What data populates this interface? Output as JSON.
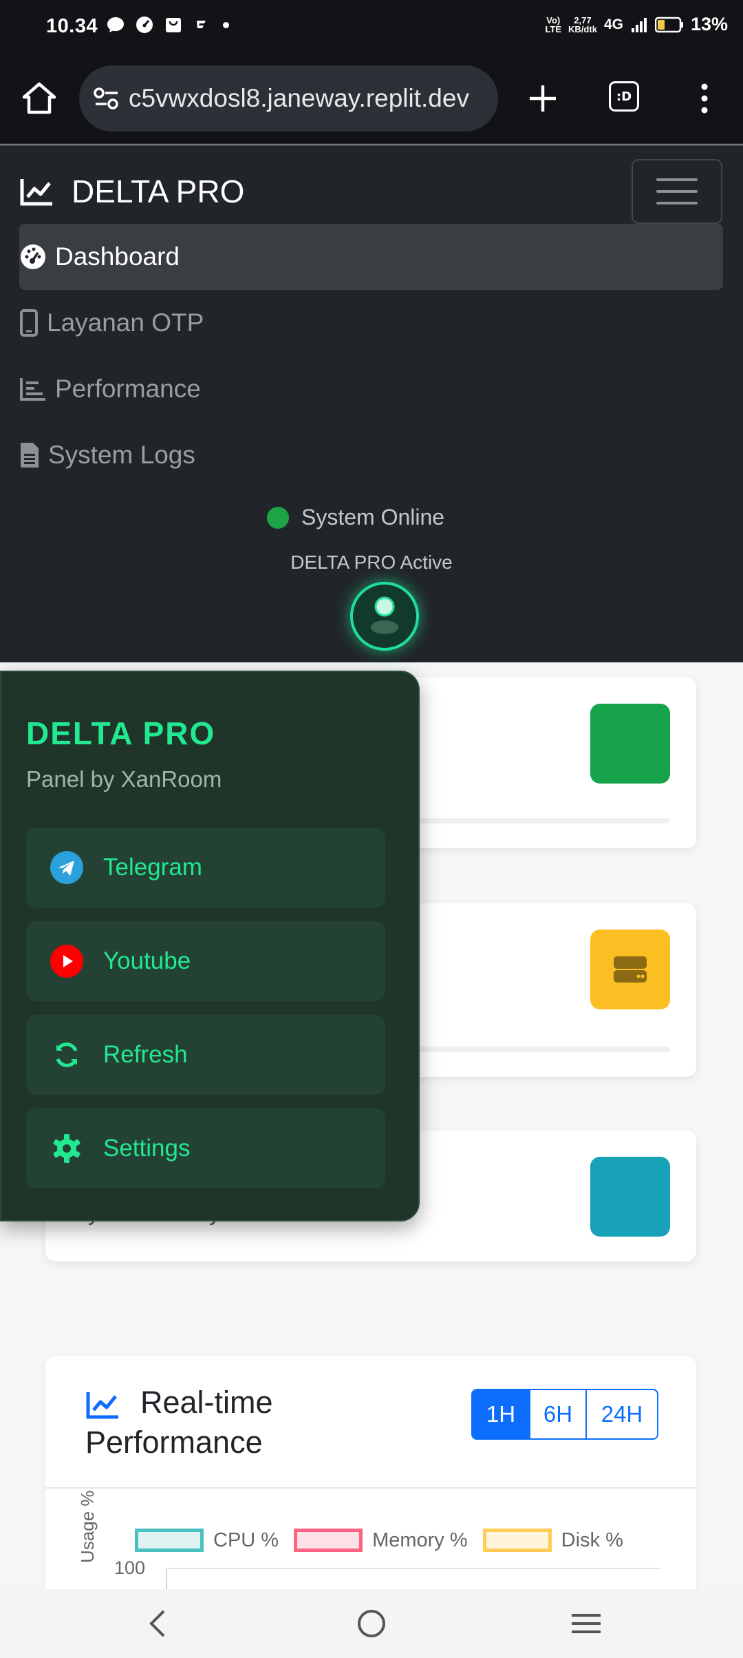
{
  "status_bar": {
    "time": "10.34",
    "lte_label": "VoLTE",
    "speed_value": "2,77",
    "speed_unit": "KB/dtk",
    "network": "4G",
    "battery": "13%"
  },
  "browser": {
    "url": "c5vwxdosl8.janeway.replit.dev",
    "tabs_label": ":D"
  },
  "navbar": {
    "brand": "DELTA PRO",
    "items": [
      {
        "label": "Dashboard",
        "active": true
      },
      {
        "label": "Layanan OTP",
        "active": false
      },
      {
        "label": "Performance",
        "active": false
      },
      {
        "label": "System Logs",
        "active": false
      }
    ],
    "status": "System Online",
    "active_text": "DELTA PRO Active"
  },
  "cards": [
    {
      "icon_color": "#16a34a"
    },
    {
      "icon_color": "#fbbf24"
    },
    {
      "icon_color": "#17a2b8",
      "subtitle": "System Ready"
    }
  ],
  "overlay": {
    "title": "DELTA PRO",
    "subtitle": "Panel by XanRoom",
    "buttons": [
      {
        "label": "Telegram",
        "icon": "telegram-icon"
      },
      {
        "label": "Youtube",
        "icon": "youtube-icon"
      },
      {
        "label": "Refresh",
        "icon": "refresh-icon"
      },
      {
        "label": "Settings",
        "icon": "gear-icon"
      }
    ]
  },
  "performance": {
    "title_line1": "Real-time",
    "title_line2": "Performance",
    "ranges": [
      "1H",
      "6H",
      "24H"
    ],
    "selected_range": "1H",
    "chart_data": {
      "type": "line",
      "series": [
        {
          "name": "CPU %",
          "color": "#4bc0c0",
          "values": []
        },
        {
          "name": "Memory %",
          "color": "#ff6384",
          "values": []
        },
        {
          "name": "Disk %",
          "color": "#ffcd56",
          "values": []
        }
      ],
      "ylabel": "Usage %",
      "ylim": [
        0,
        100
      ],
      "y_tick_visible": "100"
    }
  },
  "colors": {
    "accent_green": "#21e891",
    "primary_blue": "#0d6efd",
    "navbar_bg": "#212529"
  }
}
